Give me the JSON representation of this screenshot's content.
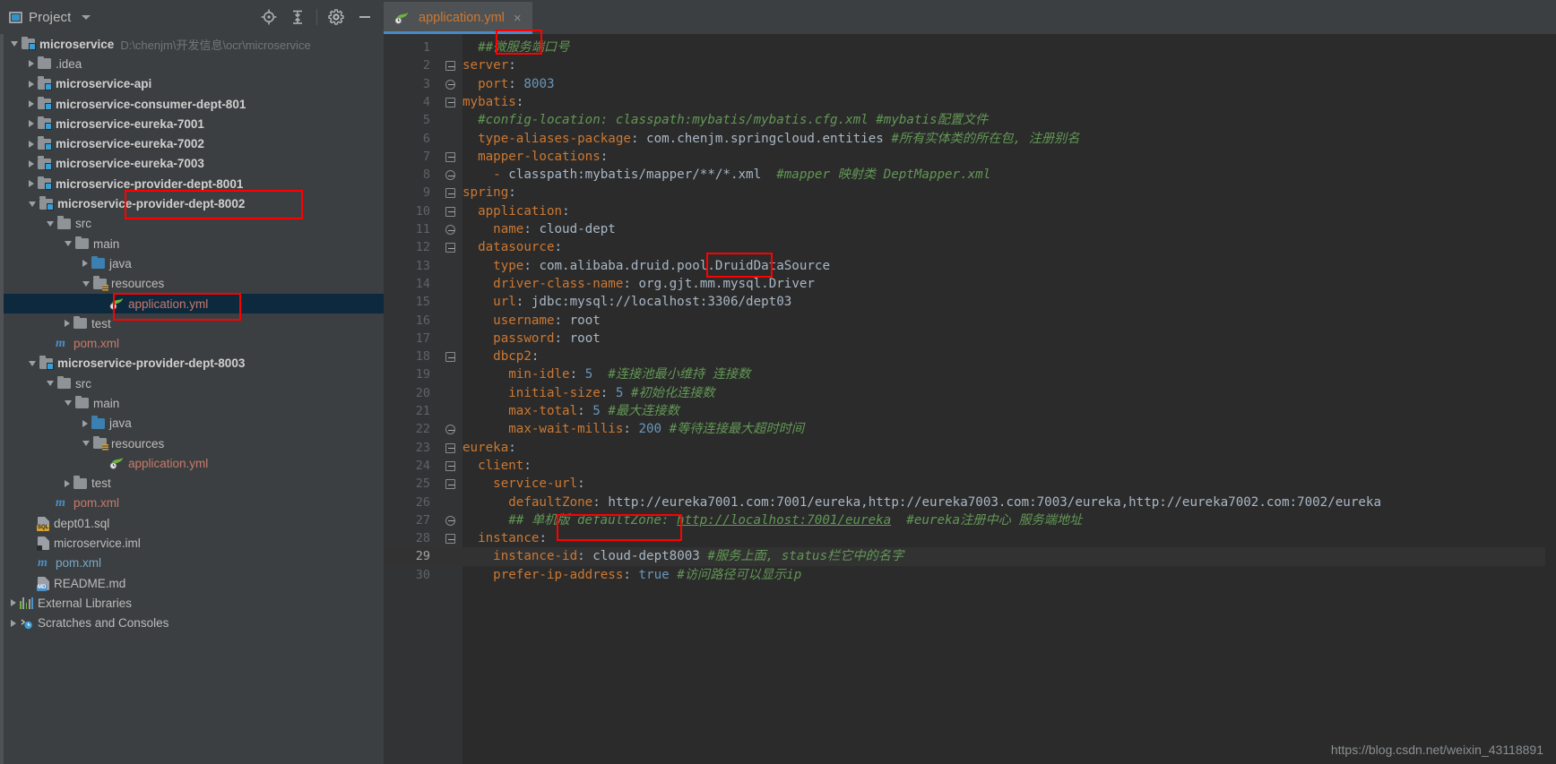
{
  "sidebar": {
    "title": "Project",
    "toolbar_icons": [
      "locate-icon",
      "collapse-all-icon",
      "settings-icon",
      "hide-icon"
    ],
    "items": [
      {
        "label": "microservice",
        "path": "D:\\chenjm\\开发信息\\ocr\\microservice",
        "indent": 0,
        "arrow": "open",
        "icon": "module-folder-icon",
        "style": "bold"
      },
      {
        "label": ".idea",
        "indent": 1,
        "arrow": "closed",
        "icon": "folder-icon",
        "style": "plain"
      },
      {
        "label": "microservice-api",
        "indent": 1,
        "arrow": "closed",
        "icon": "module-folder-icon",
        "style": "bold"
      },
      {
        "label": "microservice-consumer-dept-801",
        "indent": 1,
        "arrow": "closed",
        "icon": "module-folder-icon",
        "style": "bold"
      },
      {
        "label": "microservice-eureka-7001",
        "indent": 1,
        "arrow": "closed",
        "icon": "module-folder-icon",
        "style": "bold"
      },
      {
        "label": "microservice-eureka-7002",
        "indent": 1,
        "arrow": "closed",
        "icon": "module-folder-icon",
        "style": "bold"
      },
      {
        "label": "microservice-eureka-7003",
        "indent": 1,
        "arrow": "closed",
        "icon": "module-folder-icon",
        "style": "bold"
      },
      {
        "label": "microservice-provider-dept-8001",
        "indent": 1,
        "arrow": "closed",
        "icon": "module-folder-icon",
        "style": "bold"
      },
      {
        "label": "microservice-provider-dept-8002",
        "indent": 1,
        "arrow": "open",
        "icon": "module-folder-icon",
        "style": "bold"
      },
      {
        "label": "src",
        "indent": 2,
        "arrow": "open",
        "icon": "folder-icon",
        "style": "plain"
      },
      {
        "label": "main",
        "indent": 3,
        "arrow": "open",
        "icon": "folder-icon",
        "style": "plain"
      },
      {
        "label": "java",
        "indent": 4,
        "arrow": "closed",
        "icon": "source-folder-icon",
        "style": "plain"
      },
      {
        "label": "resources",
        "indent": 4,
        "arrow": "open",
        "icon": "resources-folder-icon",
        "style": "plain"
      },
      {
        "label": "application.yml",
        "indent": 5,
        "arrow": "none",
        "icon": "spring-file-icon",
        "style": "rose",
        "selected": true
      },
      {
        "label": "test",
        "indent": 3,
        "arrow": "closed",
        "icon": "folder-icon",
        "style": "plain"
      },
      {
        "label": "pom.xml",
        "indent": 2,
        "arrow": "none",
        "icon": "maven-icon",
        "style": "rose"
      },
      {
        "label": "microservice-provider-dept-8003",
        "indent": 1,
        "arrow": "open",
        "icon": "module-folder-icon",
        "style": "bold"
      },
      {
        "label": "src",
        "indent": 2,
        "arrow": "open",
        "icon": "folder-icon",
        "style": "plain"
      },
      {
        "label": "main",
        "indent": 3,
        "arrow": "open",
        "icon": "folder-icon",
        "style": "plain"
      },
      {
        "label": "java",
        "indent": 4,
        "arrow": "closed",
        "icon": "source-folder-icon",
        "style": "plain"
      },
      {
        "label": "resources",
        "indent": 4,
        "arrow": "open",
        "icon": "resources-folder-icon",
        "style": "plain"
      },
      {
        "label": "application.yml",
        "indent": 5,
        "arrow": "none",
        "icon": "spring-file-icon",
        "style": "rose"
      },
      {
        "label": "test",
        "indent": 3,
        "arrow": "closed",
        "icon": "folder-icon",
        "style": "plain"
      },
      {
        "label": "pom.xml",
        "indent": 2,
        "arrow": "none",
        "icon": "maven-icon",
        "style": "rose"
      },
      {
        "label": "dept01.sql",
        "indent": 1,
        "arrow": "none",
        "icon": "sql-file-icon",
        "style": "plain"
      },
      {
        "label": "microservice.iml",
        "indent": 1,
        "arrow": "none",
        "icon": "iml-file-icon",
        "style": "plain"
      },
      {
        "label": "pom.xml",
        "indent": 1,
        "arrow": "none",
        "icon": "maven-icon",
        "style": "blue"
      },
      {
        "label": "README.md",
        "indent": 1,
        "arrow": "none",
        "icon": "markdown-file-icon",
        "style": "plain"
      },
      {
        "label": "External Libraries",
        "indent": 0,
        "arrow": "closed",
        "icon": "libraries-icon",
        "style": "plain"
      },
      {
        "label": "Scratches and Consoles",
        "indent": 0,
        "arrow": "closed",
        "icon": "scratches-icon",
        "style": "plain"
      }
    ]
  },
  "editor": {
    "tab": {
      "label": "application.yml",
      "icon": "spring-file-icon",
      "close": "×"
    },
    "highlighted_line": 29,
    "lines": [
      {
        "n": 1,
        "fold": "",
        "segs": [
          {
            "t": "  ",
            "c": "p"
          },
          {
            "t": "##微服务端口号",
            "c": "c"
          }
        ]
      },
      {
        "n": 2,
        "fold": "open",
        "segs": [
          {
            "t": "server",
            "c": "k"
          },
          {
            "t": ":",
            "c": "p"
          }
        ]
      },
      {
        "n": 3,
        "fold": "end",
        "segs": [
          {
            "t": "  ",
            "c": "p"
          },
          {
            "t": "port",
            "c": "k"
          },
          {
            "t": ": ",
            "c": "p"
          },
          {
            "t": "8003",
            "c": "n"
          }
        ]
      },
      {
        "n": 4,
        "fold": "open",
        "segs": [
          {
            "t": "mybatis",
            "c": "k"
          },
          {
            "t": ":",
            "c": "p"
          }
        ]
      },
      {
        "n": 5,
        "fold": "",
        "segs": [
          {
            "t": "  ",
            "c": "p"
          },
          {
            "t": "#config-location: classpath:mybatis/mybatis.cfg.xml #mybatis配置文件",
            "c": "c"
          }
        ]
      },
      {
        "n": 6,
        "fold": "",
        "segs": [
          {
            "t": "  ",
            "c": "p"
          },
          {
            "t": "type-aliases-package",
            "c": "k"
          },
          {
            "t": ": ",
            "c": "p"
          },
          {
            "t": "com.chenjm.springcloud.entities ",
            "c": "s"
          },
          {
            "t": "#所有实体类的所在包, 注册别名",
            "c": "c"
          }
        ]
      },
      {
        "n": 7,
        "fold": "open",
        "segs": [
          {
            "t": "  ",
            "c": "p"
          },
          {
            "t": "mapper-locations",
            "c": "k"
          },
          {
            "t": ":",
            "c": "p"
          }
        ]
      },
      {
        "n": 8,
        "fold": "end",
        "segs": [
          {
            "t": "    - ",
            "c": "k"
          },
          {
            "t": "classpath:mybatis/mapper/**/*.xml  ",
            "c": "s"
          },
          {
            "t": "#mapper 映射类 DeptMapper.xml",
            "c": "c"
          }
        ]
      },
      {
        "n": 9,
        "fold": "open",
        "segs": [
          {
            "t": "spring",
            "c": "k"
          },
          {
            "t": ":",
            "c": "p"
          }
        ]
      },
      {
        "n": 10,
        "fold": "open",
        "segs": [
          {
            "t": "  ",
            "c": "p"
          },
          {
            "t": "application",
            "c": "k"
          },
          {
            "t": ":",
            "c": "p"
          }
        ]
      },
      {
        "n": 11,
        "fold": "end",
        "segs": [
          {
            "t": "    ",
            "c": "p"
          },
          {
            "t": "name",
            "c": "k"
          },
          {
            "t": ": ",
            "c": "p"
          },
          {
            "t": "cloud-dept",
            "c": "s"
          }
        ]
      },
      {
        "n": 12,
        "fold": "open",
        "segs": [
          {
            "t": "  ",
            "c": "p"
          },
          {
            "t": "datasource",
            "c": "k"
          },
          {
            "t": ":",
            "c": "p"
          }
        ]
      },
      {
        "n": 13,
        "fold": "",
        "segs": [
          {
            "t": "    ",
            "c": "p"
          },
          {
            "t": "type",
            "c": "k"
          },
          {
            "t": ": ",
            "c": "p"
          },
          {
            "t": "com.alibaba.druid.pool.DruidDataSource",
            "c": "s"
          }
        ]
      },
      {
        "n": 14,
        "fold": "",
        "segs": [
          {
            "t": "    ",
            "c": "p"
          },
          {
            "t": "driver-class-name",
            "c": "k"
          },
          {
            "t": ": ",
            "c": "p"
          },
          {
            "t": "org.gjt.mm.mysql.Driver",
            "c": "s"
          }
        ]
      },
      {
        "n": 15,
        "fold": "",
        "segs": [
          {
            "t": "    ",
            "c": "p"
          },
          {
            "t": "url",
            "c": "k"
          },
          {
            "t": ": ",
            "c": "p"
          },
          {
            "t": "jdbc:mysql://localhost:3306/dept03",
            "c": "s"
          }
        ]
      },
      {
        "n": 16,
        "fold": "",
        "segs": [
          {
            "t": "    ",
            "c": "p"
          },
          {
            "t": "username",
            "c": "k"
          },
          {
            "t": ": ",
            "c": "p"
          },
          {
            "t": "root",
            "c": "s"
          }
        ]
      },
      {
        "n": 17,
        "fold": "",
        "segs": [
          {
            "t": "    ",
            "c": "p"
          },
          {
            "t": "password",
            "c": "k"
          },
          {
            "t": ": ",
            "c": "p"
          },
          {
            "t": "root",
            "c": "s"
          }
        ]
      },
      {
        "n": 18,
        "fold": "open",
        "segs": [
          {
            "t": "    ",
            "c": "p"
          },
          {
            "t": "dbcp2",
            "c": "k"
          },
          {
            "t": ":",
            "c": "p"
          }
        ]
      },
      {
        "n": 19,
        "fold": "",
        "segs": [
          {
            "t": "      ",
            "c": "p"
          },
          {
            "t": "min-idle",
            "c": "k"
          },
          {
            "t": ": ",
            "c": "p"
          },
          {
            "t": "5",
            "c": "n"
          },
          {
            "t": "  ",
            "c": "p"
          },
          {
            "t": "#连接池最小维持 连接数",
            "c": "c"
          }
        ]
      },
      {
        "n": 20,
        "fold": "",
        "segs": [
          {
            "t": "      ",
            "c": "p"
          },
          {
            "t": "initial-size",
            "c": "k"
          },
          {
            "t": ": ",
            "c": "p"
          },
          {
            "t": "5",
            "c": "n"
          },
          {
            "t": " ",
            "c": "p"
          },
          {
            "t": "#初始化连接数",
            "c": "c"
          }
        ]
      },
      {
        "n": 21,
        "fold": "",
        "segs": [
          {
            "t": "      ",
            "c": "p"
          },
          {
            "t": "max-total",
            "c": "k"
          },
          {
            "t": ": ",
            "c": "p"
          },
          {
            "t": "5",
            "c": "n"
          },
          {
            "t": " ",
            "c": "p"
          },
          {
            "t": "#最大连接数",
            "c": "c"
          }
        ]
      },
      {
        "n": 22,
        "fold": "end",
        "segs": [
          {
            "t": "      ",
            "c": "p"
          },
          {
            "t": "max-wait-millis",
            "c": "k"
          },
          {
            "t": ": ",
            "c": "p"
          },
          {
            "t": "200",
            "c": "n"
          },
          {
            "t": " ",
            "c": "p"
          },
          {
            "t": "#等待连接最大超时时间",
            "c": "c"
          }
        ]
      },
      {
        "n": 23,
        "fold": "open",
        "segs": [
          {
            "t": "eureka",
            "c": "k"
          },
          {
            "t": ":",
            "c": "p"
          }
        ]
      },
      {
        "n": 24,
        "fold": "open",
        "segs": [
          {
            "t": "  ",
            "c": "p"
          },
          {
            "t": "client",
            "c": "k"
          },
          {
            "t": ":",
            "c": "p"
          }
        ]
      },
      {
        "n": 25,
        "fold": "open",
        "segs": [
          {
            "t": "    ",
            "c": "p"
          },
          {
            "t": "service-url",
            "c": "k"
          },
          {
            "t": ":",
            "c": "p"
          }
        ]
      },
      {
        "n": 26,
        "fold": "",
        "segs": [
          {
            "t": "      ",
            "c": "p"
          },
          {
            "t": "defaultZone",
            "c": "k"
          },
          {
            "t": ": ",
            "c": "p"
          },
          {
            "t": "http://eureka7001.com:7001/eureka,http://eureka7003.com:7003/eureka,http://eureka7002.com:7002/eureka",
            "c": "s"
          }
        ]
      },
      {
        "n": 27,
        "fold": "end",
        "segs": [
          {
            "t": "      ",
            "c": "p"
          },
          {
            "t": "## 单机版 defaultZone: ",
            "c": "c"
          },
          {
            "t": "http://localhost:7001/eureka",
            "c": "cu"
          },
          {
            "t": "  #eureka注册中心 服务端地址",
            "c": "c"
          }
        ]
      },
      {
        "n": 28,
        "fold": "open",
        "segs": [
          {
            "t": "  ",
            "c": "p"
          },
          {
            "t": "instance",
            "c": "k"
          },
          {
            "t": ":",
            "c": "p"
          }
        ]
      },
      {
        "n": 29,
        "fold": "",
        "segs": [
          {
            "t": "    ",
            "c": "p"
          },
          {
            "t": "instance-id",
            "c": "k"
          },
          {
            "t": ": ",
            "c": "p"
          },
          {
            "t": "cloud-dept8003",
            "c": "s"
          },
          {
            "t": " ",
            "c": "p"
          },
          {
            "t": "#服务上面, status栏它中的名字",
            "c": "c"
          }
        ]
      },
      {
        "n": 30,
        "fold": "",
        "segs": [
          {
            "t": "    ",
            "c": "p"
          },
          {
            "t": "prefer-ip-address",
            "c": "k"
          },
          {
            "t": ": ",
            "c": "p"
          },
          {
            "t": "true",
            "c": "n"
          },
          {
            "t": " ",
            "c": "p"
          },
          {
            "t": "#访问路径可以显示ip",
            "c": "c"
          }
        ]
      }
    ]
  },
  "watermark": "https://blog.csdn.net/weixin_43118891",
  "colors": {
    "panel_bg": "#3c3f41",
    "editor_bg": "#2b2b2b",
    "gutter_bg": "#313335",
    "selection_bg": "#0d293e",
    "accent": "#4a88c7",
    "annotation_red": "#ff0000",
    "key_orange": "#cc7832",
    "comment_green": "#629755",
    "number_blue": "#6897bb",
    "text_grey": "#a9b7c6"
  }
}
